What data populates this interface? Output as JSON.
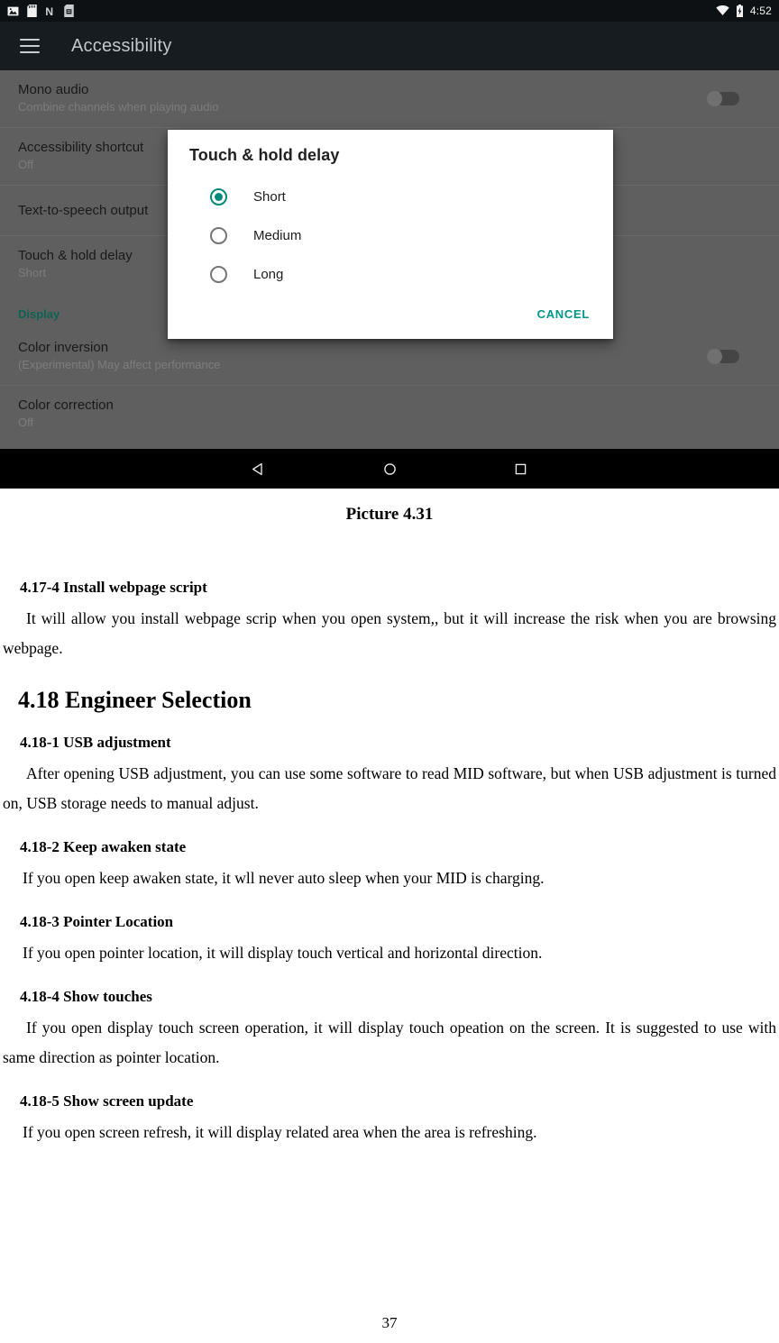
{
  "device_screenshot": {
    "status_bar": {
      "icons": [
        "image-icon",
        "sd-card-icon",
        "nfc-icon",
        "sd-card-storage-icon"
      ],
      "wifi_icon": "wifi-icon",
      "battery_icon": "battery-charging-icon",
      "time": "4:52"
    },
    "app_bar": {
      "menu_icon": "hamburger-menu-icon",
      "title": "Accessibility"
    },
    "settings_rows": [
      {
        "title": "Mono audio",
        "subtitle": "Combine channels when playing audio",
        "has_switch": true,
        "switch_state": "off"
      },
      {
        "title": "Accessibility shortcut",
        "subtitle": "Off",
        "has_switch": false
      },
      {
        "title": "Text-to-speech output",
        "subtitle": "",
        "has_switch": false
      },
      {
        "title": "Touch & hold delay",
        "subtitle": "Short",
        "has_switch": false
      }
    ],
    "section_header": "Display",
    "settings_rows_2": [
      {
        "title": "Color inversion",
        "subtitle": "(Experimental) May affect performance",
        "has_switch": true,
        "switch_state": "off"
      },
      {
        "title": "Color correction",
        "subtitle": "Off",
        "has_switch": false
      }
    ],
    "dialog": {
      "title": "Touch & hold delay",
      "options": [
        {
          "label": "Short",
          "selected": true
        },
        {
          "label": "Medium",
          "selected": false
        },
        {
          "label": "Long",
          "selected": false
        }
      ],
      "cancel_label": "CANCEL"
    },
    "nav_bar": {
      "back_icon": "back-triangle-icon",
      "home_icon": "home-circle-icon",
      "recents_icon": "recents-square-icon"
    },
    "colors": {
      "accent_teal": "#009688",
      "section_header_teal": "#12705f",
      "status_bar_bg": "#0d1114",
      "app_bar_bg": "#171c20",
      "list_bg": "#6d6d6d",
      "nav_bar_bg": "#000000"
    }
  },
  "document": {
    "caption": "Picture 4.31",
    "sections": [
      {
        "heading": "4.17-4 Install webpage script",
        "heading_level": "h3",
        "body": "It will allow you install webpage scrip when you open system,, but it will increase the risk when you are browsing webpage."
      },
      {
        "heading": "4.18 Engineer Selection",
        "heading_level": "h2",
        "body": ""
      },
      {
        "heading": "4.18-1 USB adjustment",
        "heading_level": "h3",
        "body": "After opening USB adjustment, you can use some software to read MID software, but when USB adjustment is turned on, USB storage needs to manual adjust."
      },
      {
        "heading": "4.18-2 Keep awaken state",
        "heading_level": "h3",
        "body": "If you open keep awaken state, it wll never auto sleep when your MID is charging."
      },
      {
        "heading": "4.18-3 Pointer Location",
        "heading_level": "h3",
        "body": "If you open pointer location, it will display touch vertical and horizontal direction."
      },
      {
        "heading": "4.18-4 Show touches",
        "heading_level": "h3",
        "body": "If you open display touch screen operation, it will display touch opeation on the screen. It is suggested to use with same direction as pointer location."
      },
      {
        "heading": "4.18-5 Show screen update",
        "heading_level": "h3",
        "body": "If you open screen refresh, it will display related area when the area is refreshing."
      }
    ],
    "page_number": "37"
  }
}
